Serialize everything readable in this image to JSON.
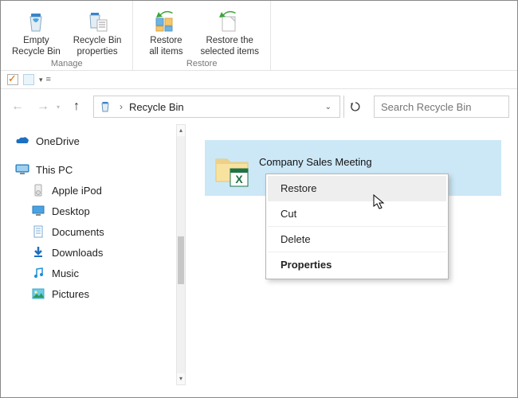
{
  "ribbon": {
    "groups": [
      {
        "label": "Manage",
        "buttons": [
          {
            "label": "Empty\nRecycle Bin"
          },
          {
            "label": "Recycle Bin\nproperties"
          }
        ]
      },
      {
        "label": "Restore",
        "buttons": [
          {
            "label": "Restore\nall items"
          },
          {
            "label": "Restore the\nselected items"
          }
        ]
      }
    ]
  },
  "address": {
    "location": "Recycle Bin"
  },
  "search": {
    "placeholder": "Search Recycle Bin"
  },
  "nav": {
    "onedrive": "OneDrive",
    "thispc": "This PC",
    "items": [
      "Apple iPod",
      "Desktop",
      "Documents",
      "Downloads",
      "Music",
      "Pictures"
    ]
  },
  "file": {
    "name": "Company Sales Meeting"
  },
  "context_menu": {
    "items": [
      "Restore",
      "Cut",
      "Delete",
      "Properties"
    ]
  }
}
